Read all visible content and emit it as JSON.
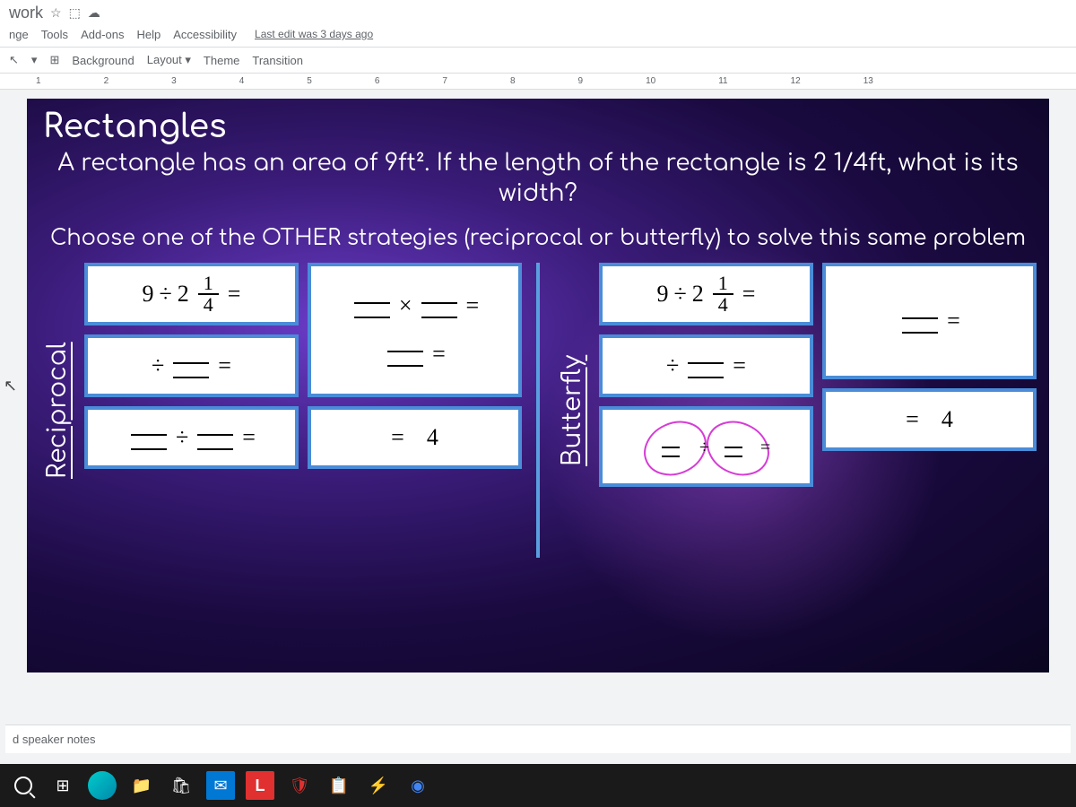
{
  "header": {
    "doc_title_fragment": "work",
    "last_edit": "Last edit was 3 days ago"
  },
  "menus": {
    "m1": "nge",
    "m2": "Tools",
    "m3": "Add-ons",
    "m4": "Help",
    "m5": "Accessibility"
  },
  "toolbar": {
    "background": "Background",
    "layout": "Layout",
    "theme": "Theme",
    "transition": "Transition"
  },
  "ruler": {
    "n1": "1",
    "n2": "2",
    "n3": "3",
    "n4": "4",
    "n5": "5",
    "n6": "6",
    "n7": "7",
    "n8": "8",
    "n9": "9",
    "n10": "10",
    "n11": "11",
    "n12": "12",
    "n13": "13"
  },
  "slide": {
    "title": "Rectangles",
    "subtitle": "A rectangle has an area of 9ft². If the length of the rectangle is 2 1/4ft, what is its width?",
    "instruction": "Choose one of the OTHER strategies (reciprocal or butterfly) to solve this same problem",
    "label_reciprocal": "Reciprocal",
    "label_butterfly": "Butterfly",
    "expr_base_9": "9",
    "expr_div": "÷",
    "expr_2": "2",
    "frac_1": "1",
    "frac_4": "4",
    "eq": "=",
    "times": "×",
    "result_4": "4"
  },
  "footer": {
    "speaker_notes": "d speaker notes"
  },
  "taskbar_icons": {
    "search": "O",
    "task": "⊞",
    "edge": "e",
    "explorer": "📁",
    "store": "🛍",
    "mail": "✉",
    "l": "L",
    "shield": "🛡",
    "note": "📋",
    "bolt": "⚡",
    "chrome": "◉"
  }
}
